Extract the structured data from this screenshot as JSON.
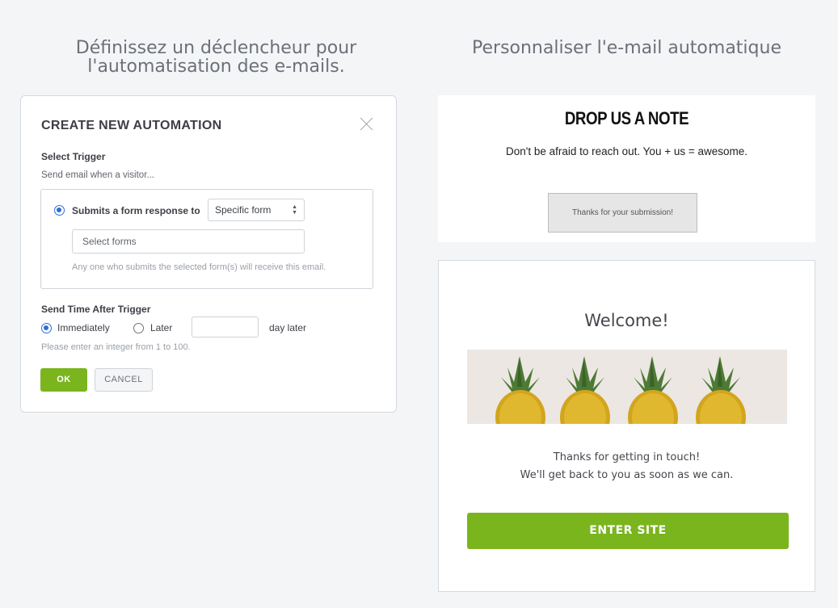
{
  "headings": {
    "left": [
      "Définissez un déclencheur pour",
      "l'automatisation des e-mails."
    ],
    "right": "Personnaliser l'e-mail automatique"
  },
  "modal": {
    "title": "CREATE NEW AUTOMATION",
    "select_trigger_label": "Select Trigger",
    "send_email_when": "Send email when a visitor...",
    "trigger_option": "Submits a form response to",
    "form_select_value": "Specific form",
    "forms_input_placeholder": "Select forms",
    "trigger_hint": "Any one who submits the selected form(s) will receive this email.",
    "send_time_label": "Send Time After Trigger",
    "immediately_label": "Immediately",
    "later_label": "Later",
    "days_input_value": "",
    "day_later_label": "day later",
    "integer_hint": "Please enter an integer  from 1 to 100.",
    "ok_label": "OK",
    "cancel_label": "CANCEL"
  },
  "note_card": {
    "title": "DROP US A NOTE",
    "subtitle": "Don't be afraid to reach out. You + us = awesome.",
    "toast": "Thanks for your submission!"
  },
  "email": {
    "heading": "Welcome!",
    "line1": "Thanks for getting in touch!",
    "line2": "We'll get back to you as soon as we can.",
    "button_label": "ENTER SITE"
  },
  "colors": {
    "accent_green": "#7ab51d",
    "radio_blue": "#2a6ed8",
    "background": "#f4f5f7"
  }
}
